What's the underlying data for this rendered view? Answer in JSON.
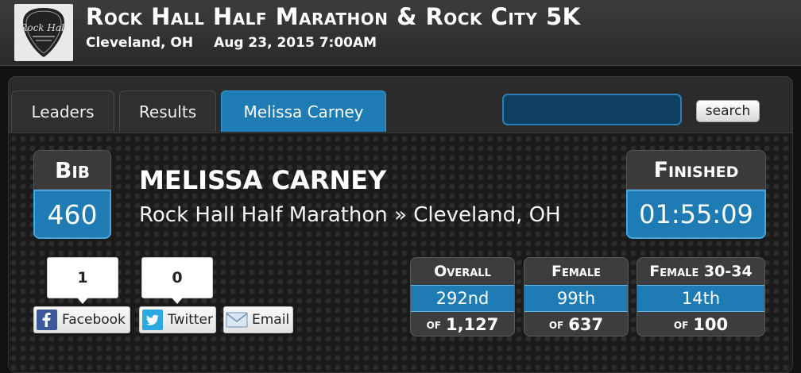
{
  "event": {
    "title": "Rock Hall Half Marathon & Rock City 5K",
    "location": "Cleveland, OH",
    "datetime": "Aug 23, 2015 7:00AM",
    "logo_icon": "rock-hall-guitar-pick-logo",
    "logo_text": "Rock Hall"
  },
  "tabs": [
    {
      "label": "Leaders",
      "active": false
    },
    {
      "label": "Results",
      "active": false
    },
    {
      "label": "Melissa Carney",
      "active": true
    }
  ],
  "search": {
    "placeholder": "",
    "value": "",
    "button_label": "search"
  },
  "runner": {
    "bib_label": "Bib",
    "bib": "460",
    "name": "MELISSA CARNEY",
    "race_line": "Rock Hall Half Marathon » Cleveland, OH",
    "finished_label": "Finished",
    "finish_time": "01:55:09"
  },
  "social": {
    "facebook": {
      "count": "1",
      "label": "Facebook",
      "icon": "facebook-icon"
    },
    "twitter": {
      "count": "0",
      "label": "Twitter",
      "icon": "twitter-icon"
    },
    "email": {
      "label": "Email",
      "icon": "envelope-icon"
    }
  },
  "rankings": [
    {
      "label": "Overall",
      "place": "292nd",
      "of_label": "of",
      "total": "1,127"
    },
    {
      "label": "Female",
      "place": "99th",
      "of_label": "of",
      "total": "637"
    },
    {
      "label": "Female 30-34",
      "place": "14th",
      "of_label": "of",
      "total": "100"
    }
  ],
  "colors": {
    "accent_blue": "#1e7bb3",
    "header_bg": "#333333",
    "panel_bg": "#1a1a1a"
  }
}
